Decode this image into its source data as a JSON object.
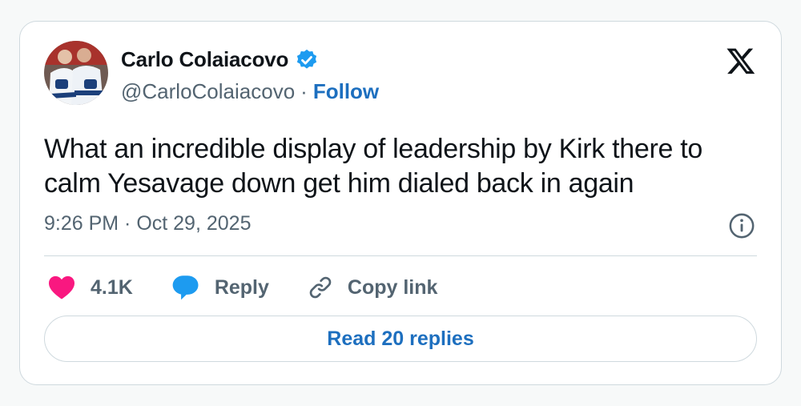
{
  "author": {
    "display_name": "Carlo Colaiacovo",
    "handle": "@CarloColaiacovo",
    "separator": "·",
    "follow_label": "Follow",
    "avatar_icon": "profile-photo-hockey-players",
    "verified_icon": "verified-badge-icon",
    "verified_color": "#1d9bf0"
  },
  "brand": {
    "logo_icon": "x-logo-icon"
  },
  "tweet": {
    "text": "What an incredible display of leadership by Kirk there to calm Yesavage down get him dialed back in again",
    "timestamp": "9:26 PM · Oct 29, 2025",
    "info_icon": "info-icon"
  },
  "actions": {
    "like": {
      "icon": "heart-icon",
      "count": "4.1K",
      "color": "#f91880"
    },
    "reply": {
      "icon": "speech-bubble-icon",
      "label": "Reply",
      "color": "#1d9bf0"
    },
    "copy": {
      "icon": "link-icon",
      "label": "Copy link"
    }
  },
  "footer": {
    "read_replies_label": "Read 20 replies"
  },
  "colors": {
    "link": "#1d6fbf",
    "text": "#0f1419",
    "muted": "#536471",
    "border": "#cfd9de"
  }
}
